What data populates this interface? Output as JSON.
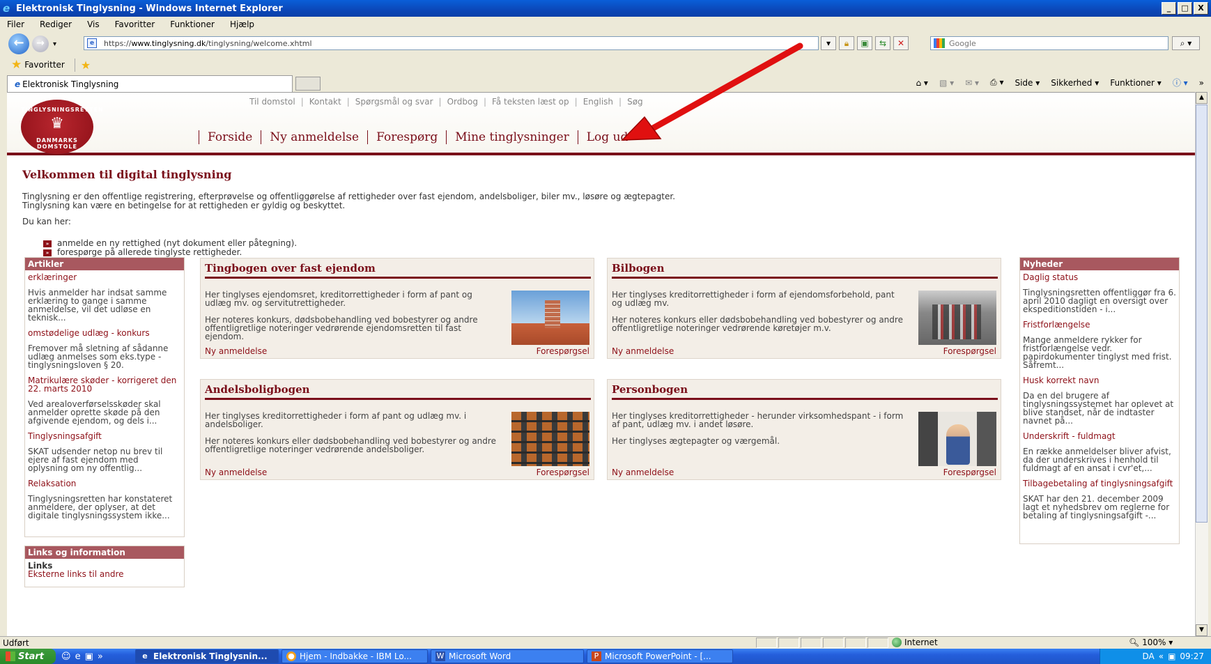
{
  "window": {
    "title": "Elektronisk Tinglysning - Windows Internet Explorer",
    "min": "_",
    "max": "□",
    "close": "X"
  },
  "menu": [
    "Filer",
    "Rediger",
    "Vis",
    "Favoritter",
    "Funktioner",
    "Hjælp"
  ],
  "address": {
    "url_scheme": "https://",
    "url_host": "www.tinglysning.dk",
    "url_path": "/tinglysning/welcome.xhtml",
    "search_placeholder": "Google"
  },
  "favorites": {
    "label": "Favoritter"
  },
  "tab": {
    "title": "Elektronisk Tinglysning"
  },
  "commands": [
    "Side ▾",
    "Sikkerhed ▾",
    "Funktioner ▾"
  ],
  "logo": {
    "top": "TINGLYSNINGSRETTEN",
    "bottom": "DANMARKS DOMSTOLE"
  },
  "toplinks": [
    "Til domstol",
    "Kontakt",
    "Spørgsmål og svar",
    "Ordbog",
    "Få teksten læst op",
    "English",
    "Søg"
  ],
  "mainnav": [
    "Forside",
    "Ny anmeldelse",
    "Forespørg",
    "Mine tinglysninger",
    "Log ud"
  ],
  "welcome": {
    "title": "Velkommen til digital tinglysning",
    "line1": "Tinglysning er den offentlige registrering, efterprøvelse og offentliggørelse af rettigheder over fast ejendom, andelsboliger, biler mv., løsøre og ægtepagter.",
    "line2": "Tinglysning kan være en betingelse for at rettigheden er gyldig og beskyttet.",
    "canhere": "Du kan her:",
    "bullets": [
      "anmelde en ny rettighed (nyt dokument eller påtegning).",
      "forespørge på allerede tinglyste rettigheder."
    ]
  },
  "articles": {
    "header": "Artikler",
    "items": [
      {
        "link": "erklæringer",
        "text": "Hvis anmelder har indsat samme erklæring to gange i samme anmeldelse, vil det udløse en teknisk..."
      },
      {
        "link": "omstødelige udlæg - konkurs",
        "text": "Fremover må sletning af sådanne udlæg anmelses som eks.type - tinglysningsloven § 20."
      },
      {
        "link": "Matrikulære skøder - korrigeret den 22. marts 2010",
        "text": "Ved arealoverførselsskøder skal anmelder oprette skøde på den afgivende ejendom, og dels i..."
      },
      {
        "link": "Tinglysningsafgift",
        "text": "SKAT udsender netop nu brev til ejere af fast ejendom med oplysning om ny offentlig..."
      },
      {
        "link": "Relaksation",
        "text": "Tinglysningsretten har konstateret anmeldere, der oplyser, at det digitale tinglysningssystem ikke..."
      }
    ]
  },
  "links": {
    "header": "Links og information",
    "sub": "Links",
    "first": "Eksterne links til andre"
  },
  "news": {
    "header": "Nyheder",
    "items": [
      {
        "link": "Daglig status",
        "text": "Tinglysningsretten offentliggør fra 6. april 2010 dagligt en oversigt over ekspeditionstiden - i..."
      },
      {
        "link": "Fristforlængelse",
        "text": "Mange anmeldere rykker for fristforlængelse vedr. papirdokumenter tinglyst med frist. Såfremt..."
      },
      {
        "link": "Husk korrekt navn",
        "text": "Da en del brugere af tinglysningssystemet har oplevet at blive standset, når de indtaster navnet på..."
      },
      {
        "link": "Underskrift - fuldmagt",
        "text": "En række anmeldelser bliver afvist, da der underskrives i henhold til fuldmagt af en ansat i cvr'et,..."
      },
      {
        "link": "Tilbagebetaling af tinglysningsafgift",
        "text": "SKAT har den 21. december 2009 lagt et nyhedsbrev om reglerne for betaling af tinglysningsafgift -..."
      }
    ]
  },
  "books": [
    {
      "title": "Tingbogen over fast ejendom",
      "p1": "Her tinglyses ejendomsret, kreditorrettigheder i form af pant og udlæg mv. og servitutrettigheder.",
      "p2": "Her noteres konkurs, dødsbobehandling ved bobestyrer og andre offentligretlige noteringer vedrørende ejendomsretten til fast ejendom.",
      "new": "Ny anmeldelse",
      "query": "Forespørgsel"
    },
    {
      "title": "Bilbogen",
      "p1": "Her tinglyses kreditorrettigheder i form af ejendomsforbehold, pant og udlæg mv.",
      "p2": "Her noteres konkurs eller dødsbobehandling ved bobestyrer og andre offentligretlige noteringer vedrørende køretøjer m.v.",
      "new": "Ny anmeldelse",
      "query": "Forespørgsel"
    },
    {
      "title": "Andelsboligbogen",
      "p1": "Her tinglyses kreditorrettigheder i form af pant og udlæg mv. i andelsboliger.",
      "p2": "Her noteres konkurs eller dødsbobehandling ved bobestyrer og andre offentligretlige noteringer vedrørende andelsboliger.",
      "new": "Ny anmeldelse",
      "query": "Forespørgsel"
    },
    {
      "title": "Personbogen",
      "p1": "Her tinglyses kreditorrettigheder - herunder virksomhedspant - i form af pant, udlæg mv. i andet løsøre.",
      "p2": "Her tinglyses ægtepagter og værgemål.",
      "new": "Ny anmeldelse",
      "query": "Forespørgsel"
    }
  ],
  "status": {
    "text": "Udført",
    "zone": "Internet",
    "zoom": "100%"
  },
  "taskbar": {
    "start": "Start",
    "tasks": [
      "Elektronisk Tinglysnin...",
      "Hjem - Indbakke - IBM Lo...",
      "Microsoft Word",
      "Microsoft PowerPoint - [..."
    ],
    "clock": "09:27"
  },
  "colors": {
    "brand": "#7a0e1a",
    "link": "#8e1018",
    "sidehead": "#a8585f",
    "arrow": "#e01010"
  }
}
